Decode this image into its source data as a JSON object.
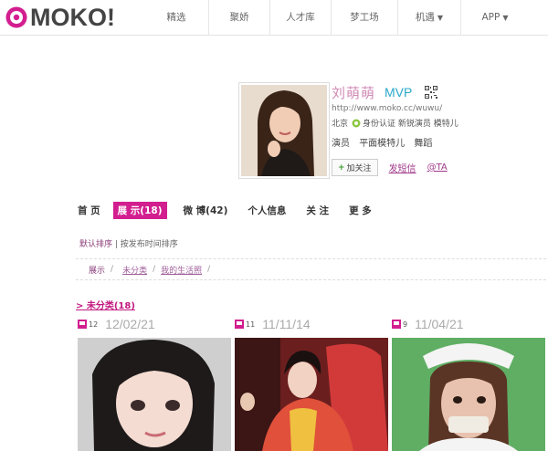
{
  "header": {
    "logo_text": "MOKO!",
    "brand_color": "#d21e8f",
    "nav": [
      {
        "label": "精选"
      },
      {
        "label": "聚娇"
      },
      {
        "label": "人才库"
      },
      {
        "label": "梦工场"
      },
      {
        "label": "机遇",
        "caret": "▼"
      },
      {
        "label": "APP",
        "caret": "▼"
      }
    ]
  },
  "profile": {
    "name": "刘萌萌",
    "badge": "MVP",
    "qr_icon": "qr-code-icon",
    "url": "http://www.moko.cc/wuwu/",
    "location": "北京",
    "verified_text": "身份认证 新锐演员 模特儿",
    "tags": [
      "演员",
      "平面模特儿",
      "舞蹈"
    ],
    "follow_label": "加关注",
    "message_label": "发短信",
    "at_label": "@TA"
  },
  "tabs": [
    {
      "label": "首 页",
      "active": false
    },
    {
      "label": "展 示(18)",
      "active": true
    },
    {
      "label": "微 博(42)",
      "active": false
    },
    {
      "label": "个人信息",
      "active": false
    },
    {
      "label": "关 注",
      "active": false
    },
    {
      "label": "更 多",
      "active": false
    }
  ],
  "sort": {
    "default": "默认排序",
    "sep": " | ",
    "by_time": "按发布时间排序"
  },
  "breadcrumb": {
    "items": [
      "展示",
      "未分类",
      "我的生活照"
    ],
    "separator": "/"
  },
  "category": {
    "label": "> 未分类(18)"
  },
  "albums": [
    {
      "count": "12",
      "date": "12/02/21"
    },
    {
      "count": "11",
      "date": "11/11/14"
    },
    {
      "count": "9",
      "date": "11/04/21"
    }
  ]
}
